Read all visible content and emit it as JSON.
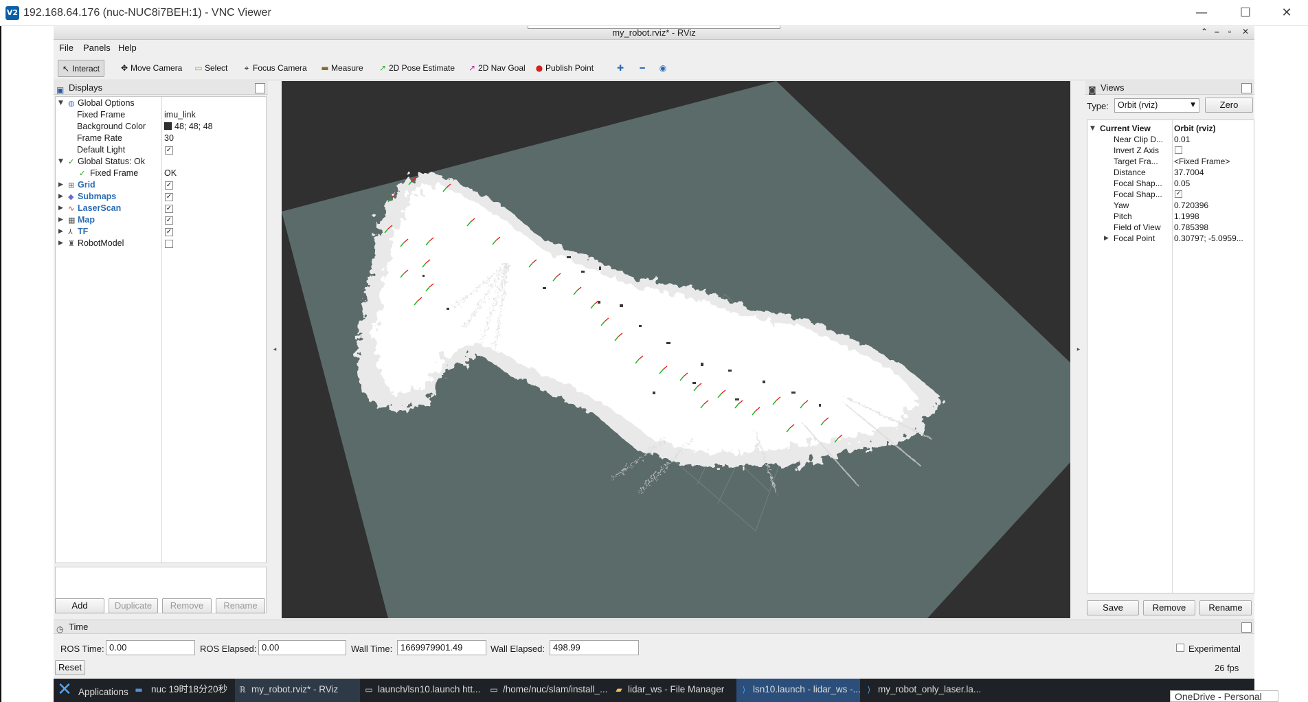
{
  "vnc": {
    "title": "192.168.64.176 (nuc-NUC8i7BEH:1) - VNC Viewer",
    "logo": "V2",
    "controls": {
      "minimize": "—",
      "maximize": "☐",
      "close": "✕"
    }
  },
  "rviz": {
    "title": "my_robot.rviz* - RViz",
    "controls": {
      "up": "⌃",
      "min": "–",
      "max": "▫",
      "close": "✕"
    }
  },
  "menu": {
    "file": "File",
    "panels": "Panels",
    "help": "Help"
  },
  "toolbar": {
    "interact": "Interact",
    "move_camera": "Move Camera",
    "select": "Select",
    "focus_camera": "Focus Camera",
    "measure": "Measure",
    "pose_estimate": "2D Pose Estimate",
    "nav_goal": "2D Nav Goal",
    "publish_point": "Publish Point"
  },
  "displays": {
    "header": "Displays",
    "rows": {
      "global_options": "Global Options",
      "fixed_frame_label": "Fixed Frame",
      "fixed_frame_value": "imu_link",
      "bg_color_label": "Background Color",
      "bg_color_value": "48; 48; 48",
      "frame_rate_label": "Frame Rate",
      "frame_rate_value": "30",
      "default_light_label": "Default Light",
      "global_status": "Global Status: Ok",
      "status_fixed_frame_label": "Fixed Frame",
      "status_fixed_frame_value": "OK",
      "grid": "Grid",
      "submaps": "Submaps",
      "laserscan": "LaserScan",
      "map": "Map",
      "tf": "TF",
      "robotmodel": "RobotModel"
    },
    "buttons": {
      "add": "Add",
      "duplicate": "Duplicate",
      "remove": "Remove",
      "rename": "Rename"
    }
  },
  "views": {
    "header": "Views",
    "type_label": "Type:",
    "type_value": "Orbit (rviz)",
    "zero": "Zero",
    "current_view_label": "Current View",
    "current_view_value": "Orbit (rviz)",
    "props": [
      {
        "name": "Near Clip D...",
        "value": "0.01"
      },
      {
        "name": "Invert Z Axis",
        "value": ""
      },
      {
        "name": "Target Fra...",
        "value": "<Fixed Frame>"
      },
      {
        "name": "Distance",
        "value": "37.7004"
      },
      {
        "name": "Focal Shap...",
        "value": "0.05"
      },
      {
        "name": "Focal Shap...",
        "value": ""
      },
      {
        "name": "Yaw",
        "value": "0.720396"
      },
      {
        "name": "Pitch",
        "value": "1.1998"
      },
      {
        "name": "Field of View",
        "value": "0.785398"
      },
      {
        "name": "Focal Point",
        "value": "0.30797; -5.0959..."
      }
    ],
    "buttons": {
      "save": "Save",
      "remove": "Remove",
      "rename": "Rename"
    }
  },
  "time": {
    "header": "Time",
    "ros_time_label": "ROS Time:",
    "ros_time_value": "0.00",
    "ros_elapsed_label": "ROS Elapsed:",
    "ros_elapsed_value": "0.00",
    "wall_time_label": "Wall Time:",
    "wall_time_value": "1669979901.49",
    "wall_elapsed_label": "Wall Elapsed:",
    "wall_elapsed_value": "498.99",
    "experimental": "Experimental",
    "reset": "Reset",
    "fps": "26 fps"
  },
  "taskbar": {
    "applications": "Applications",
    "clock": "nuc 19时18分20秒",
    "tasks": [
      "my_robot.rviz* - RViz",
      "launch/lsn10.launch htt...",
      "/home/nuc/slam/install_...",
      "lidar_ws - File Manager",
      "lsn10.launch - lidar_ws -...",
      "my_robot_only_laser.la..."
    ]
  },
  "onedrive": "OneDrive - Personal",
  "colors": {
    "background": "#303030",
    "map_unknown": "#5a6b69",
    "map_free": "#ffffff",
    "accent": "#2b6cb5"
  }
}
